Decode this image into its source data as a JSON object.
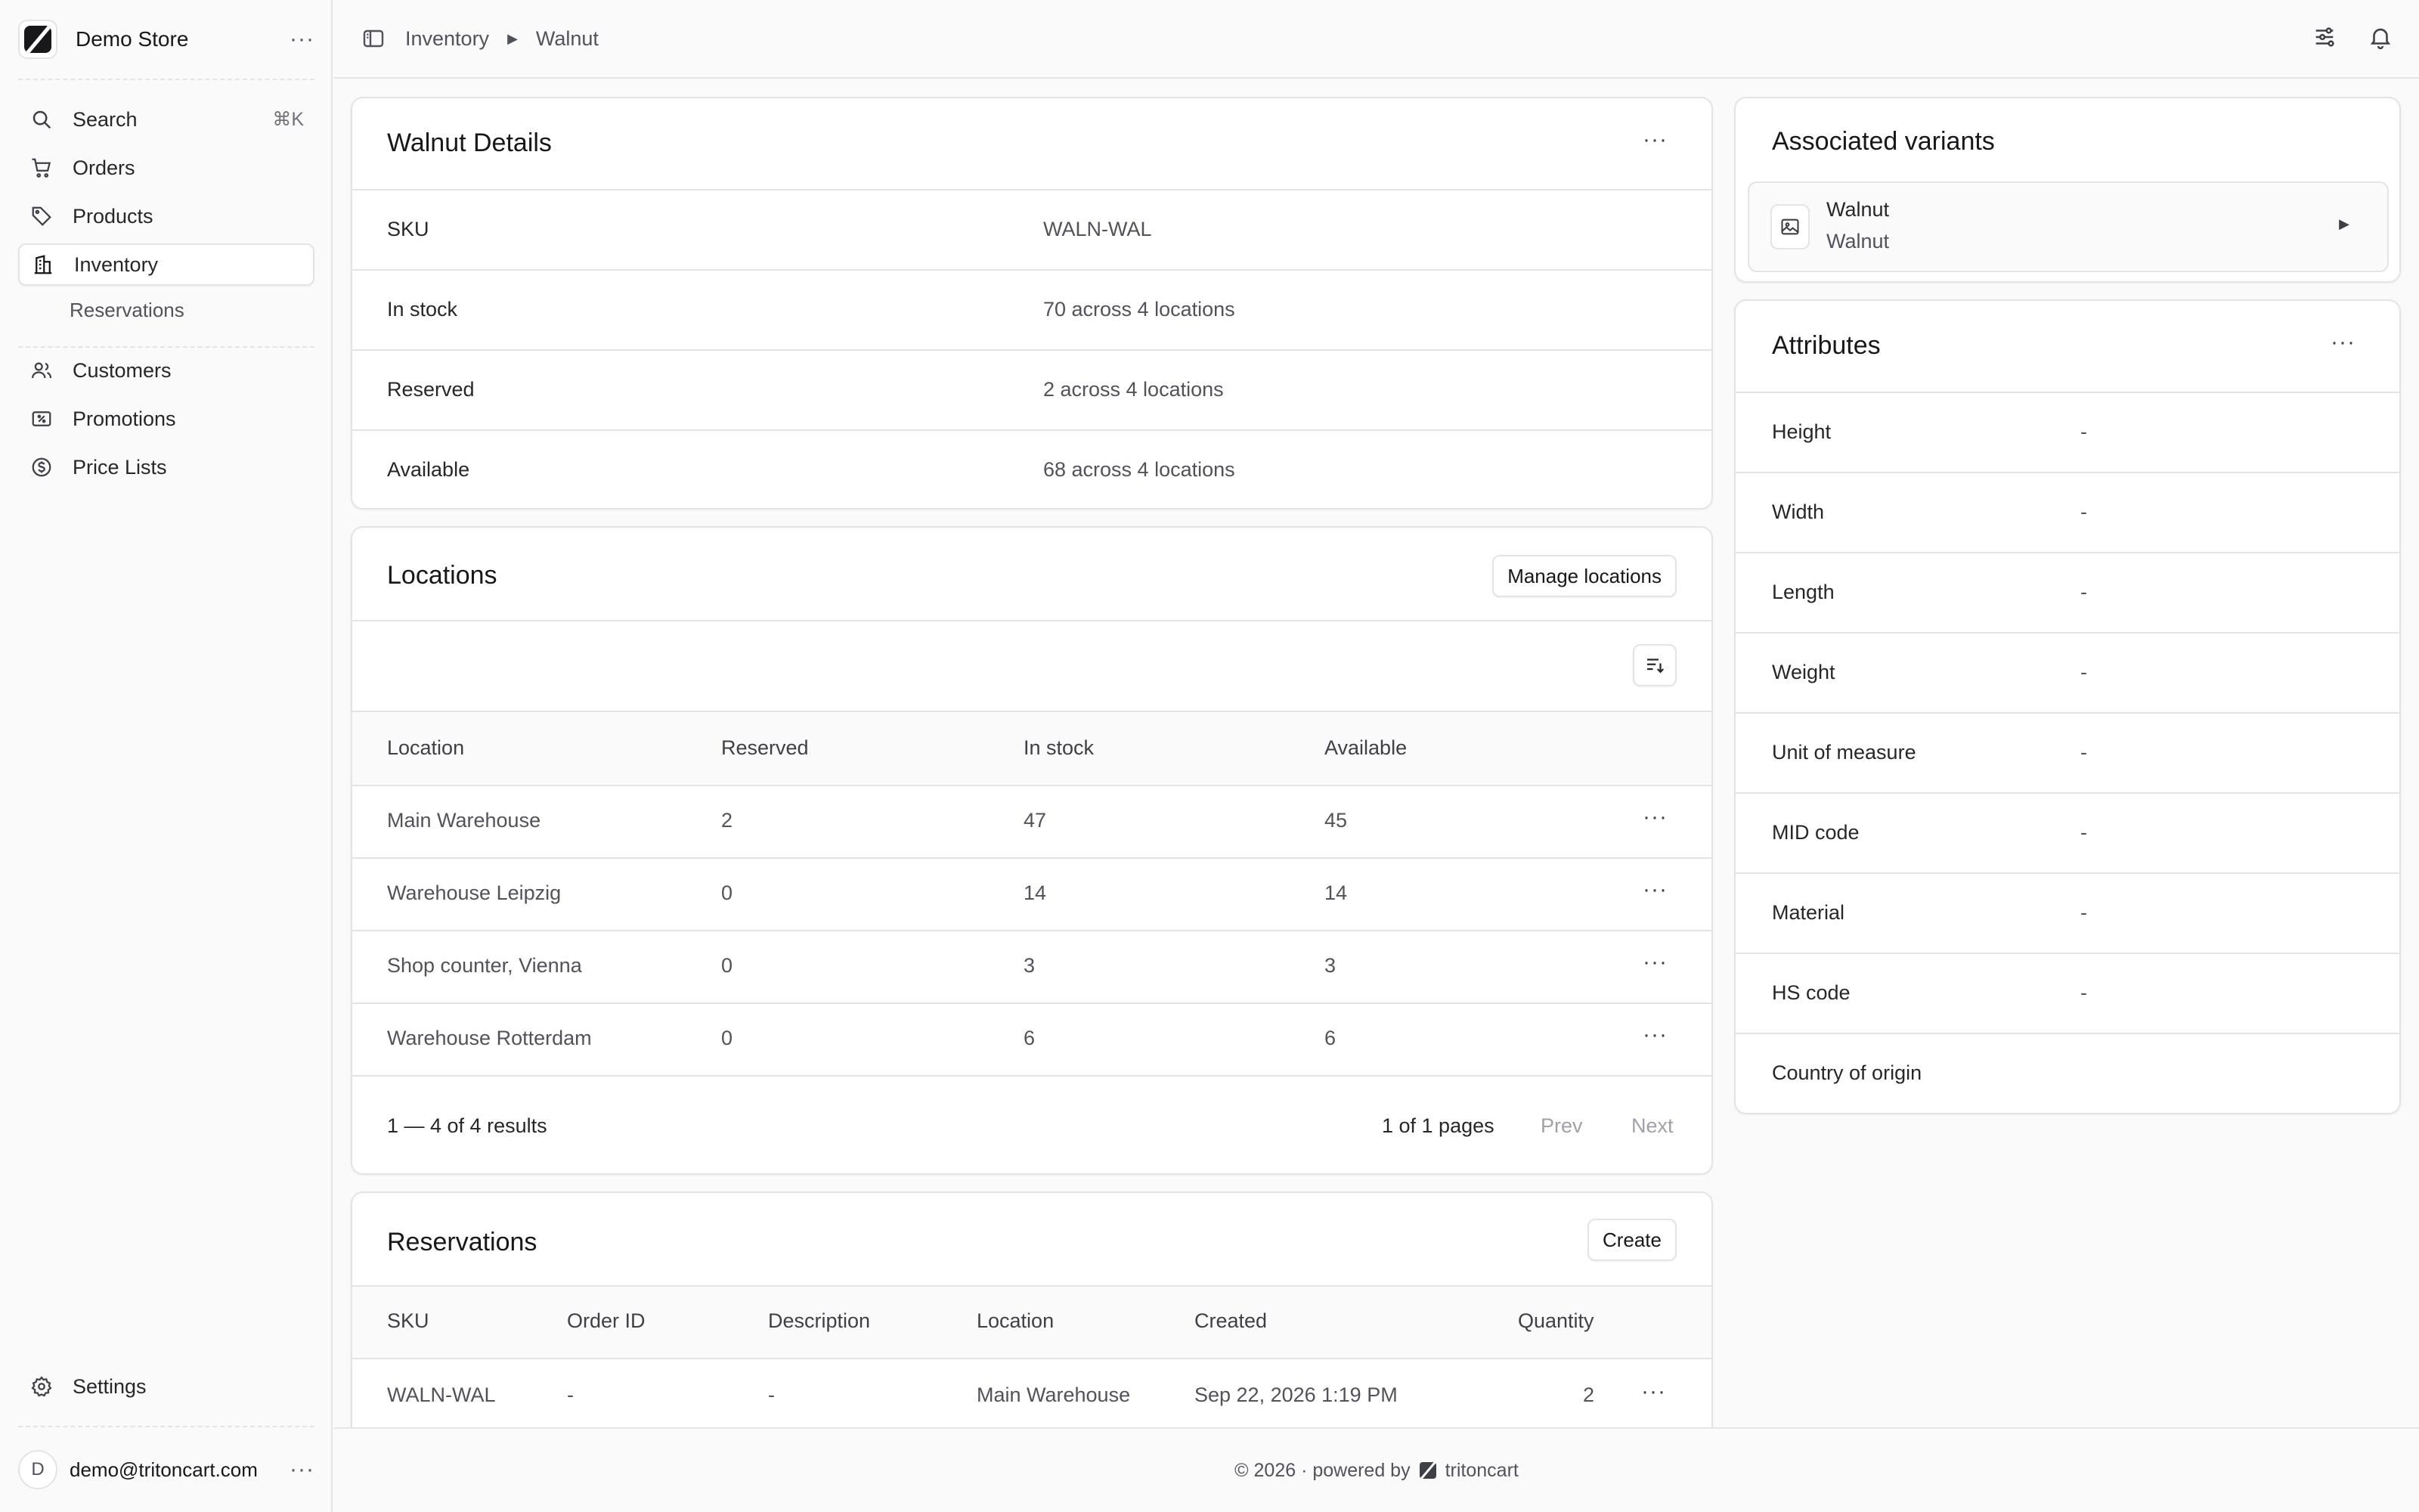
{
  "sidebar": {
    "store_name": "Demo Store",
    "search_label": "Search",
    "search_shortcut": "⌘K",
    "items": {
      "orders": "Orders",
      "products": "Products",
      "inventory": "Inventory",
      "reservations": "Reservations",
      "customers": "Customers",
      "promotions": "Promotions",
      "price_lists": "Price Lists",
      "settings": "Settings"
    },
    "user_initial": "D",
    "user_email": "demo@tritoncart.com"
  },
  "breadcrumb": [
    "Inventory",
    "Walnut"
  ],
  "details": {
    "title": "Walnut Details",
    "rows": [
      {
        "label": "SKU",
        "value": "WALN-WAL"
      },
      {
        "label": "In stock",
        "value": "70 across 4 locations"
      },
      {
        "label": "Reserved",
        "value": "2 across 4 locations"
      },
      {
        "label": "Available",
        "value": "68 across 4 locations"
      }
    ]
  },
  "locations": {
    "title": "Locations",
    "manage_label": "Manage locations",
    "columns": [
      "Location",
      "Reserved",
      "In stock",
      "Available"
    ],
    "rows": [
      {
        "location": "Main Warehouse",
        "reserved": "2",
        "in_stock": "47",
        "available": "45"
      },
      {
        "location": "Warehouse Leipzig",
        "reserved": "0",
        "in_stock": "14",
        "available": "14"
      },
      {
        "location": "Shop counter, Vienna",
        "reserved": "0",
        "in_stock": "3",
        "available": "3"
      },
      {
        "location": "Warehouse Rotterdam",
        "reserved": "0",
        "in_stock": "6",
        "available": "6"
      }
    ],
    "results": "1 — 4 of 4 results",
    "pages": "1 of 1 pages",
    "prev": "Prev",
    "next": "Next"
  },
  "reservations": {
    "title": "Reservations",
    "create_label": "Create",
    "columns": [
      "SKU",
      "Order ID",
      "Description",
      "Location",
      "Created",
      "Quantity"
    ],
    "rows": [
      {
        "sku": "WALN-WAL",
        "order_id": "-",
        "description": "-",
        "location": "Main Warehouse",
        "created": "Sep 22, 2026 1:19 PM",
        "quantity": "2"
      }
    ]
  },
  "variants": {
    "title": "Associated variants",
    "item_title": "Walnut",
    "item_subtitle": "Walnut"
  },
  "attributes": {
    "title": "Attributes",
    "rows": [
      {
        "label": "Height",
        "value": "-"
      },
      {
        "label": "Width",
        "value": "-"
      },
      {
        "label": "Length",
        "value": "-"
      },
      {
        "label": "Weight",
        "value": "-"
      },
      {
        "label": "Unit of measure",
        "value": "-"
      },
      {
        "label": "MID code",
        "value": "-"
      },
      {
        "label": "Material",
        "value": "-"
      },
      {
        "label": "HS code",
        "value": "-"
      },
      {
        "label": "Country of origin",
        "value": ""
      }
    ]
  },
  "footer": {
    "prefix": "© 2026 · powered by",
    "brand": "tritoncart"
  }
}
